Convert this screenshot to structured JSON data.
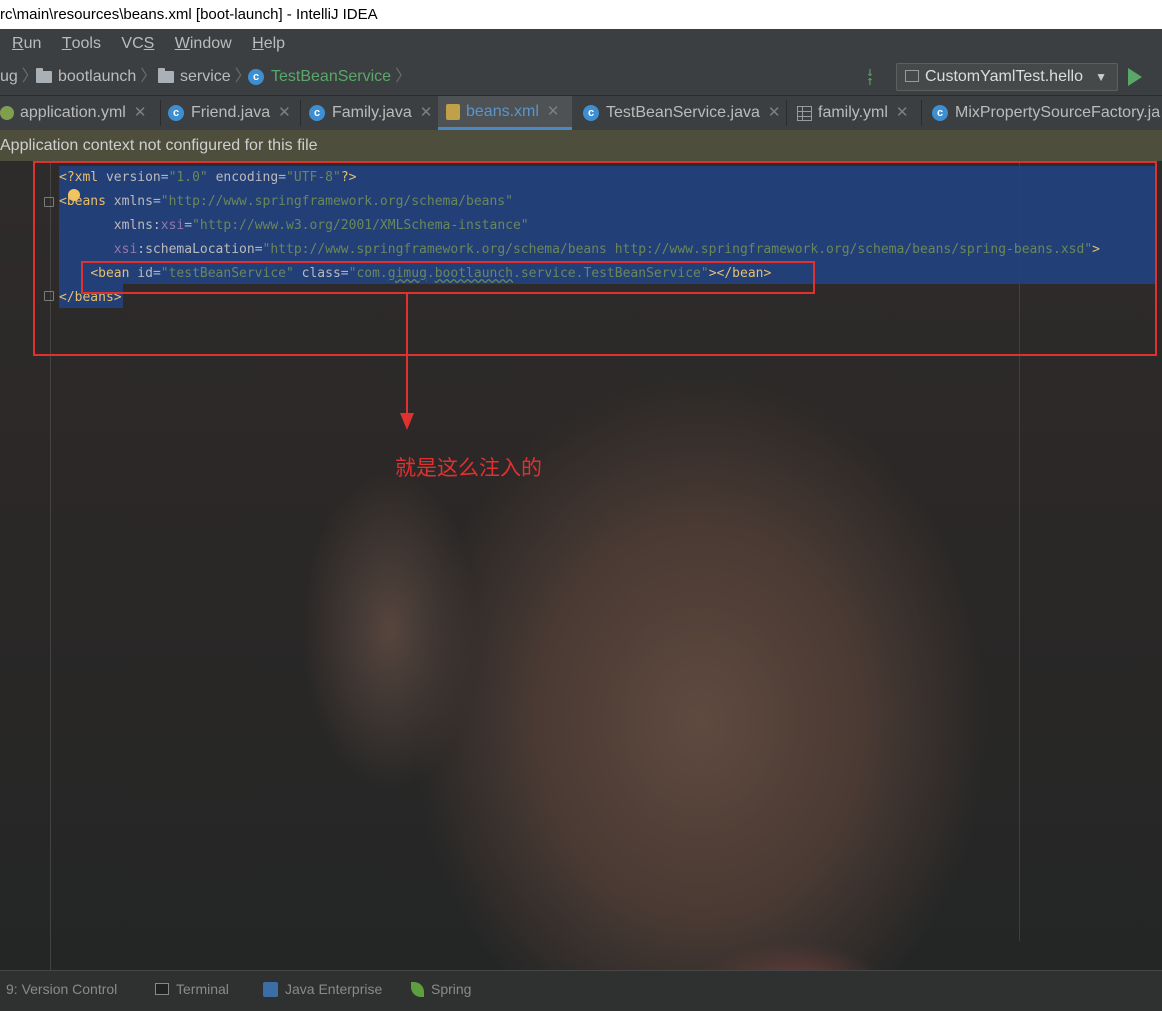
{
  "window": {
    "title": "rc\\main\\resources\\beans.xml [boot-launch] - IntelliJ IDEA"
  },
  "menu": {
    "items": [
      {
        "label": "Run",
        "mnemonic": "R",
        "rest": "un"
      },
      {
        "label": "Tools",
        "mnemonic": "T",
        "rest": "ools"
      },
      {
        "label": "VCS",
        "mnemonic": "S",
        "prefix": "VC"
      },
      {
        "label": "Window",
        "mnemonic": "W",
        "rest": "indow"
      },
      {
        "label": "Help",
        "mnemonic": "H",
        "rest": "elp"
      }
    ]
  },
  "breadcrumb": {
    "items": [
      "ug",
      "bootlaunch",
      "service",
      "TestBeanService"
    ],
    "class_color": "#59a869"
  },
  "run_config": {
    "label": "CustomYamlTest.hello",
    "run_color": "#59a869"
  },
  "tabs": [
    {
      "label": "application.yml",
      "icon": "yaml-icon"
    },
    {
      "label": "Friend.java",
      "icon": "class-icon"
    },
    {
      "label": "Family.java",
      "icon": "class-icon"
    },
    {
      "label": "beans.xml",
      "icon": "xml-icon",
      "active": true
    },
    {
      "label": "TestBeanService.java",
      "icon": "class-icon"
    },
    {
      "label": "family.yml",
      "icon": "table-icon"
    },
    {
      "label": "MixPropertySourceFactory.ja",
      "icon": "class-icon"
    }
  ],
  "banner": {
    "text": "Application context not configured for this file"
  },
  "code": {
    "line1": {
      "open": "<?xml ",
      "a1": "version",
      "eq1": "=",
      "v1": "\"1.0\"",
      "sp": " ",
      "a2": "encoding",
      "eq2": "=",
      "v2": "\"UTF-8\"",
      "close": "?>"
    },
    "line2": {
      "tag": "<beans ",
      "a1": "xmlns",
      "eq": "=",
      "v1": "\"http://www.springframework.org/schema/beans\""
    },
    "line3": {
      "pre": "       ",
      "a1": "xmlns:",
      "ns": "xsi",
      "eq": "=",
      "v1": "\"http://www.w3.org/2001/XMLSchema-instance\""
    },
    "line4": {
      "pre": "       ",
      "ns": "xsi",
      "a1": ":schemaLocation",
      "eq": "=",
      "v1": "\"http://www.springframework.org/schema/beans http://www.springframework.org/schema/beans/spring-beans.xsd\"",
      "close": ">"
    },
    "line5": {
      "pre": "    ",
      "tag": "<bean ",
      "a1": "id",
      "eq1": "=",
      "v1": "\"testBeanService\"",
      "sp": " ",
      "a2": "class",
      "eq2": "=",
      "v2a": "\"com.",
      "v2b": "gimug",
      "v2c": ".",
      "v2d": "bootlaunch",
      "v2e": ".service.TestBeanService\"",
      "close": "></bean>"
    },
    "line6": {
      "tag": "</beans>"
    }
  },
  "annotation": {
    "text": "就是这么注入的",
    "color": "#e03131"
  },
  "tool_windows": [
    {
      "label": "9: Version Control"
    },
    {
      "label": "Terminal"
    },
    {
      "label": "Java Enterprise"
    },
    {
      "label": "Spring"
    }
  ]
}
